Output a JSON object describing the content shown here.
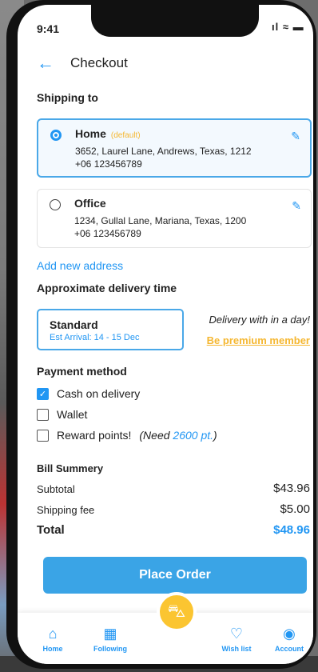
{
  "status_bar": {
    "time": "9:41",
    "icons": "ıl ≈ ▬"
  },
  "header": {
    "title": "Checkout"
  },
  "shipping": {
    "label": "Shipping to",
    "addresses": [
      {
        "name": "Home",
        "tag": "(default)",
        "line1": "3652,   Laurel Lane, Andrews, Texas, 1212",
        "phone": "+06 123456789",
        "selected": true
      },
      {
        "name": "Office",
        "tag": "",
        "line1": "1234,   Gullal Lane, Mariana, Texas, 1200",
        "phone": "+06 123456789",
        "selected": false
      }
    ],
    "add_new": "Add new address"
  },
  "delivery": {
    "label": "Approximate delivery time",
    "option_name": "Standard",
    "option_eta": "Est Arrival: 14 - 15 Dec",
    "note": "Delivery with in a day!",
    "premium_link": "Be premium member"
  },
  "payment": {
    "label": "Payment method",
    "options": [
      {
        "label": "Cash on delivery",
        "checked": true
      },
      {
        "label": "Wallet",
        "checked": false
      },
      {
        "label": "Reward points!",
        "checked": false,
        "note_prefix": "(Need ",
        "note_points": "2600 pt.",
        "note_suffix": ")"
      }
    ]
  },
  "bill": {
    "label": "Bill Summery",
    "subtotal_label": "Subtotal",
    "subtotal_value": "$43.96",
    "shipping_label": "Shipping fee",
    "shipping_value": "$5.00",
    "total_label": "Total",
    "total_value": "$48.96"
  },
  "place_order": "Place Order",
  "nav": [
    {
      "label": "Home",
      "icon": "home-icon"
    },
    {
      "label": "Following",
      "icon": "store-icon"
    },
    {
      "label": "Wish list",
      "icon": "heart-icon"
    },
    {
      "label": "Account",
      "icon": "user-icon"
    }
  ],
  "colors": {
    "accent": "#2196f3",
    "highlight": "#f5b731",
    "button": "#3aa4e6"
  }
}
